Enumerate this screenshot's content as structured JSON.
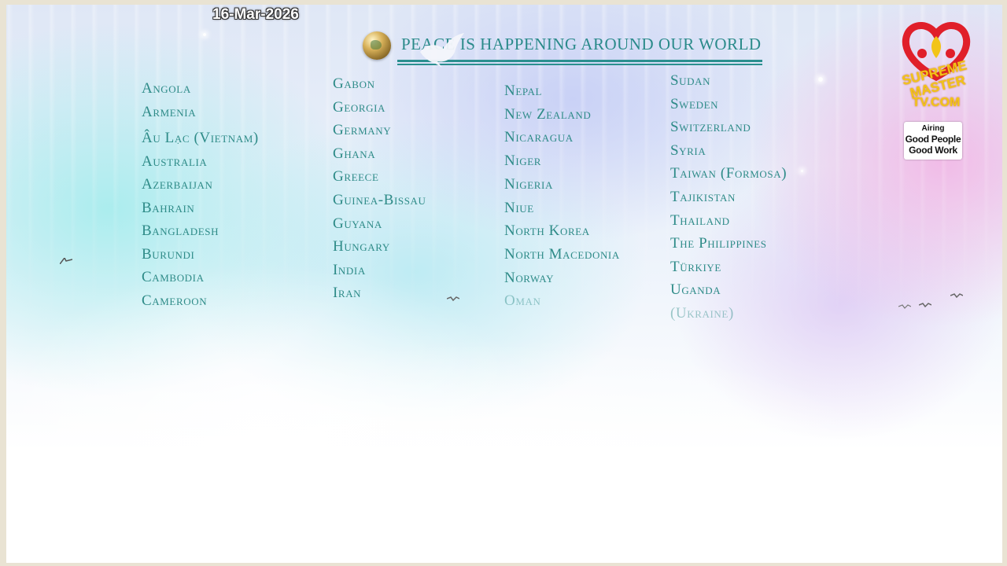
{
  "overlay": {
    "date": "16-Mar-2026"
  },
  "banner": {
    "title": "PEACE IS HAPPENING AROUND OUR WORLD",
    "globe_icon": "globe-icon",
    "dove_icon": "dove-icon"
  },
  "columns": [
    [
      "Angola",
      "Armenia",
      "Âu Lạc (Vietnam)",
      "Australia",
      "Azerbaijan",
      "Bahrain",
      "Bangladesh",
      "Burundi",
      "Cambodia",
      "Cameroon"
    ],
    [
      "Gabon",
      "Georgia",
      "Germany",
      "Ghana",
      "Greece",
      "Guinea-Bissau",
      "Guyana",
      "Hungary",
      "India",
      "Iran"
    ],
    [
      "Nepal",
      "New Zealand",
      "Nicaragua",
      "Niger",
      "Nigeria",
      "Niue",
      "North Korea",
      "North Macedonia",
      "Norway",
      "Oman"
    ],
    [
      "Sudan",
      "Sweden",
      "Switzerland",
      "Syria",
      "Taiwan (Formosa)",
      "Tajikistan",
      "Thailand",
      "The Philippines",
      "Türkiye",
      "Uganda",
      "(Ukraine)"
    ]
  ],
  "logo": {
    "line1": "SUPREME MASTER",
    "line2": "TV.COM",
    "colors": {
      "heart": "#e01f2a",
      "text": "#f2c418"
    }
  },
  "airing_badge": {
    "label": "Airing",
    "line1": "Good People",
    "line2": "Good Work"
  },
  "colors": {
    "country_text": "#2e8b88",
    "banner_text": "#2a8a8a"
  }
}
